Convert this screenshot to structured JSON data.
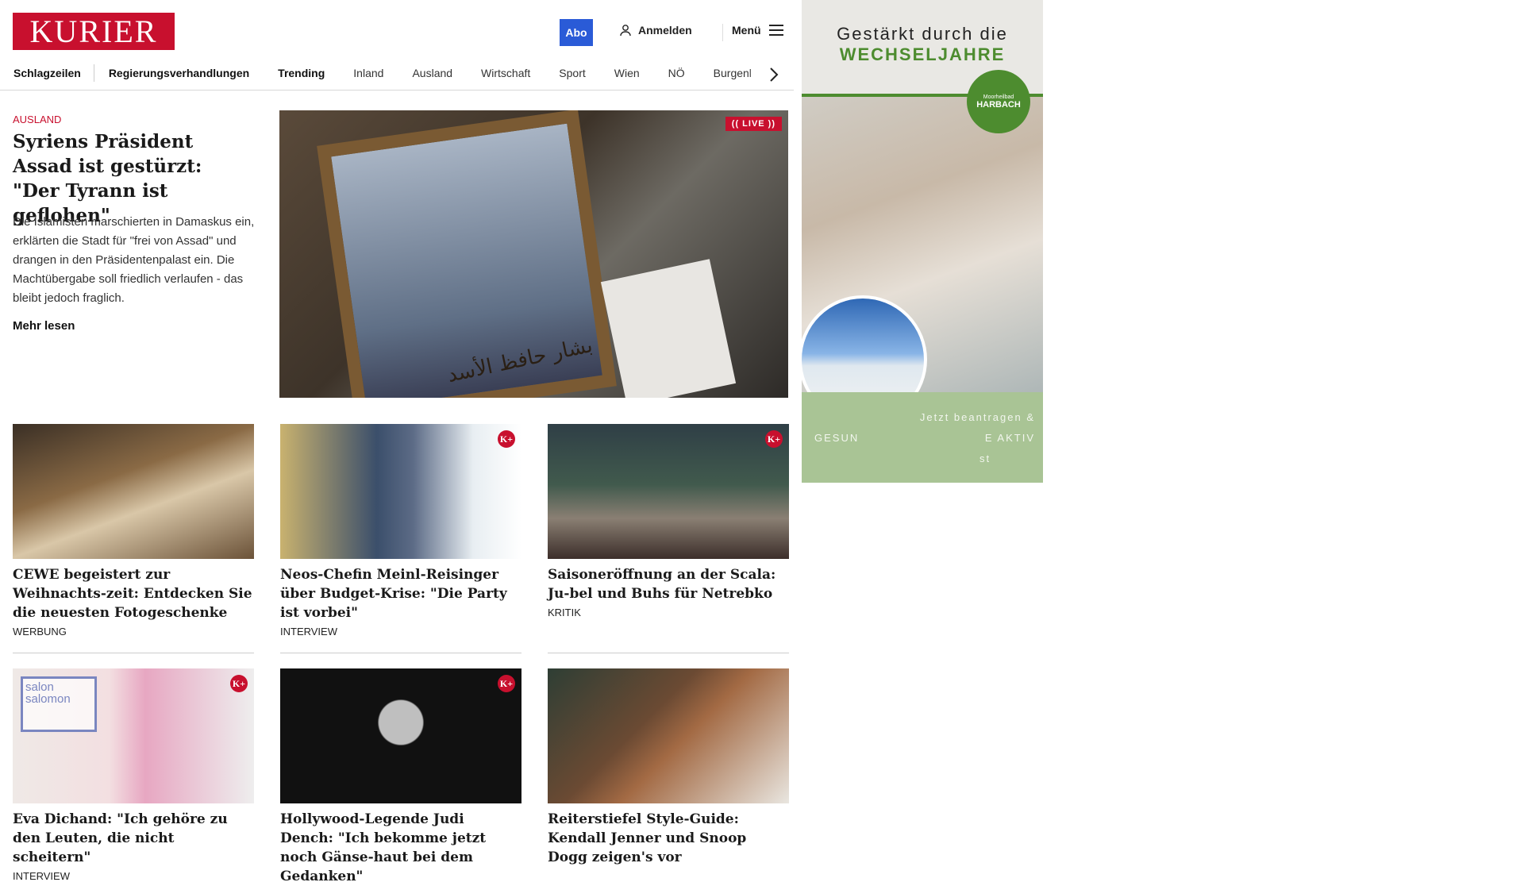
{
  "header": {
    "logo": "KURIER",
    "abo_label": "Abo",
    "login_label": "Anmelden",
    "menu_label": "Menü"
  },
  "nav": {
    "items": [
      "Schlagzeilen",
      "Regierungsverhandlungen",
      "Trending",
      "Inland",
      "Ausland",
      "Wirtschaft",
      "Sport",
      "Wien",
      "NÖ",
      "Burgenl"
    ]
  },
  "hero": {
    "kicker": "AUSLAND",
    "title": "Syriens Präsident Assad ist gestürzt: \"Der Tyrann ist geflohen\"",
    "teaser": "Die Islamisten marschierten in Damaskus ein, erklärten die Stadt für \"frei von Assad\" und drangen in den Präsidentenpalast ein. Die Machtübergabe soll friedlich verlaufen - das bleibt jedoch fraglich.",
    "more": "Mehr lesen",
    "live_badge": "(( LIVE ))",
    "image_text": "بشار حافظ الأسد"
  },
  "cards": [
    {
      "title": "CEWE begeistert zur Weihnachts-zeit: Entdecken Sie die neuesten Fotogeschenke",
      "label": "WERBUNG",
      "premium": false
    },
    {
      "title": "Neos-Chefin Meinl-Reisinger über Budget-Krise: \"Die Party ist vorbei\"",
      "label": "INTERVIEW",
      "premium": true
    },
    {
      "title": "Saisoneröffnung an der Scala: Ju-bel und Buhs für Netrebko",
      "label": "KRITIK",
      "premium": true
    },
    {
      "title": "Eva Dichand: \"Ich gehöre zu den Leuten, die nicht scheitern\"",
      "label": "INTERVIEW",
      "premium": true,
      "overlay": "salon salomon"
    },
    {
      "title": "Hollywood-Legende Judi Dench: \"Ich bekomme jetzt noch Gänse-haut bei dem Gedanken\"",
      "label": "",
      "premium": true
    },
    {
      "title": "Reiterstiefel Style-Guide: Kendall Jenner und Snoop Dogg zeigen's vor",
      "label": "",
      "premium": false
    }
  ],
  "premium_badge": "K+",
  "ad": {
    "line1": "Gestärkt durch die",
    "line2": "WECHSELJAHRE",
    "badge_small": "Moorheilbad",
    "badge_main": "HARBACH",
    "cta": "Jetzt beantragen &",
    "text_left": "GESUN",
    "text_right": "E AKTIV",
    "text_st": "st"
  },
  "colors": {
    "brand": "#c8102e",
    "abo": "#2a5bd7",
    "ad_green": "#4d8c2f"
  }
}
